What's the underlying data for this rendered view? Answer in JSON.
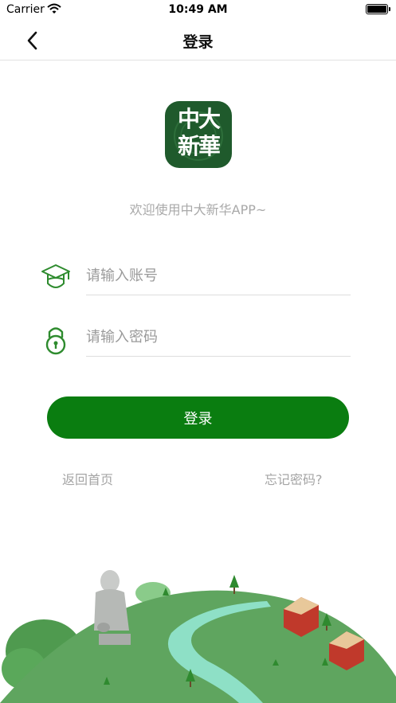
{
  "status_bar": {
    "carrier": "Carrier",
    "time": "10:49 AM",
    "battery_level": 1.0
  },
  "nav": {
    "title": "登录",
    "back_icon": "chevron-left-icon"
  },
  "logo": {
    "text": "中大新華",
    "icon": "app-logo"
  },
  "welcome": "欢迎使用中大新华APP~",
  "form": {
    "account": {
      "placeholder": "请输入账号",
      "value": "",
      "icon": "graduate-cap-icon"
    },
    "password": {
      "placeholder": "请输入密码",
      "value": "",
      "icon": "lock-icon"
    }
  },
  "login_button": "登录",
  "links": {
    "home": "返回首页",
    "forgot": "忘记密码?"
  },
  "colors": {
    "accent": "#0a7d10",
    "icon_green": "#2e8b2e",
    "logo_bg": "#1f5a2c",
    "hill": "#5fa55f",
    "river": "#8ee0c6"
  }
}
